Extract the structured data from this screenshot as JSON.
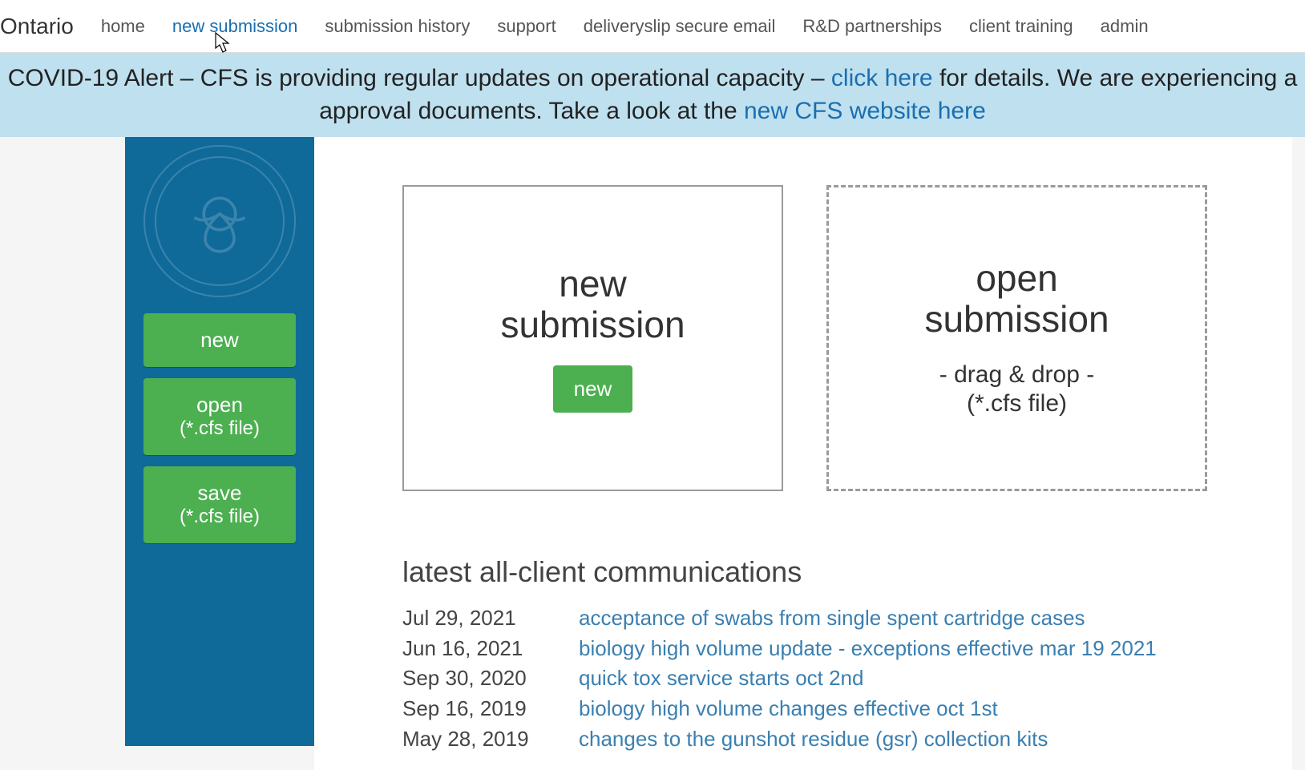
{
  "brand": "Ontario",
  "nav": {
    "items": [
      {
        "label": "home"
      },
      {
        "label": "new submission"
      },
      {
        "label": "submission history"
      },
      {
        "label": "support"
      },
      {
        "label": "deliveryslip secure email"
      },
      {
        "label": "R&D partnerships"
      },
      {
        "label": "client training"
      },
      {
        "label": "admin"
      }
    ],
    "active_index": 1
  },
  "alert": {
    "pre1": "COVID-19 Alert – CFS is providing regular updates on operational capacity – ",
    "link1": "click here",
    "post1": " for details. We are experiencing a",
    "pre2": "approval documents. Take a look at the ",
    "link2": "new CFS website here"
  },
  "sidebar": {
    "new_label": "new",
    "open_label": "open",
    "open_sub": "(*.cfs file)",
    "save_label": "save",
    "save_sub": "(*.cfs file)"
  },
  "panels": {
    "new_title_line1": "new",
    "new_title_line2": "submission",
    "new_button": "new",
    "open_title_line1": "open",
    "open_title_line2": "submission",
    "open_sub_line1": "- drag & drop -",
    "open_sub_line2": "(*.cfs file)"
  },
  "communications": {
    "heading": "latest all-client communications",
    "items": [
      {
        "date": "Jul 29, 2021",
        "title": "acceptance of swabs from single spent cartridge cases"
      },
      {
        "date": "Jun 16, 2021",
        "title": "biology high volume update - exceptions effective mar 19 2021"
      },
      {
        "date": "Sep 30, 2020",
        "title": "quick tox service starts oct 2nd"
      },
      {
        "date": "Sep 16, 2019",
        "title": "biology high volume changes effective oct 1st"
      },
      {
        "date": "May 28, 2019",
        "title": "changes to the gunshot residue (gsr) collection kits"
      }
    ]
  }
}
